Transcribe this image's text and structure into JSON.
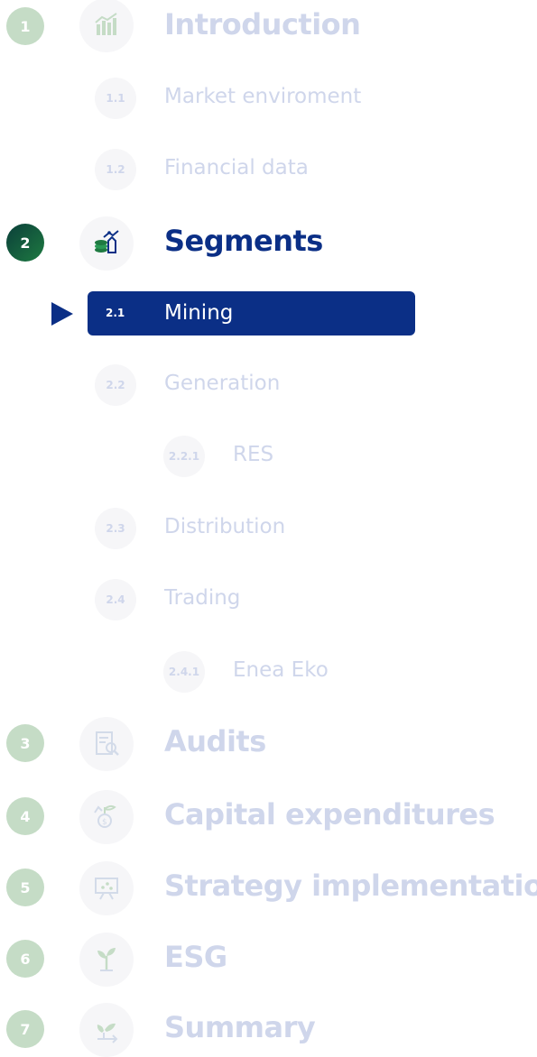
{
  "colors": {
    "active_navy": "#0b2f86",
    "inactive_text": "#cfd6eb",
    "inactive_number": "#c5dcc6",
    "active_number_gradient": [
      "#0b3f3a",
      "#1e7a41"
    ],
    "badge_bg": "#f6f6f8"
  },
  "sections": [
    {
      "number": "1",
      "title": "Introduction",
      "icon": "bar-chart-growth-icon",
      "active": false,
      "items": [
        {
          "code": "1.1",
          "label": "Market enviroment"
        },
        {
          "code": "1.2",
          "label": "Financial data"
        }
      ]
    },
    {
      "number": "2",
      "title": "Segments",
      "icon": "coins-growth-icon",
      "active": true,
      "items": [
        {
          "code": "2.1",
          "label": "Mining",
          "active": true
        },
        {
          "code": "2.2",
          "label": "Generation"
        },
        {
          "code": "2.2.1",
          "label": "RES"
        },
        {
          "code": "2.3",
          "label": "Distribution"
        },
        {
          "code": "2.4",
          "label": "Trading"
        },
        {
          "code": "2.4.1",
          "label": "Enea Eko"
        }
      ]
    },
    {
      "number": "3",
      "title": "Audits",
      "icon": "document-magnifier-icon",
      "active": false
    },
    {
      "number": "4",
      "title": "Capital expenditures",
      "icon": "money-plant-icon",
      "active": false
    },
    {
      "number": "5",
      "title": "Strategy implementation",
      "icon": "presentation-board-icon",
      "active": false
    },
    {
      "number": "6",
      "title": "ESG",
      "icon": "sprout-icon",
      "active": false
    },
    {
      "number": "7",
      "title": "Summary",
      "icon": "sprout-arrow-icon",
      "active": false
    }
  ]
}
